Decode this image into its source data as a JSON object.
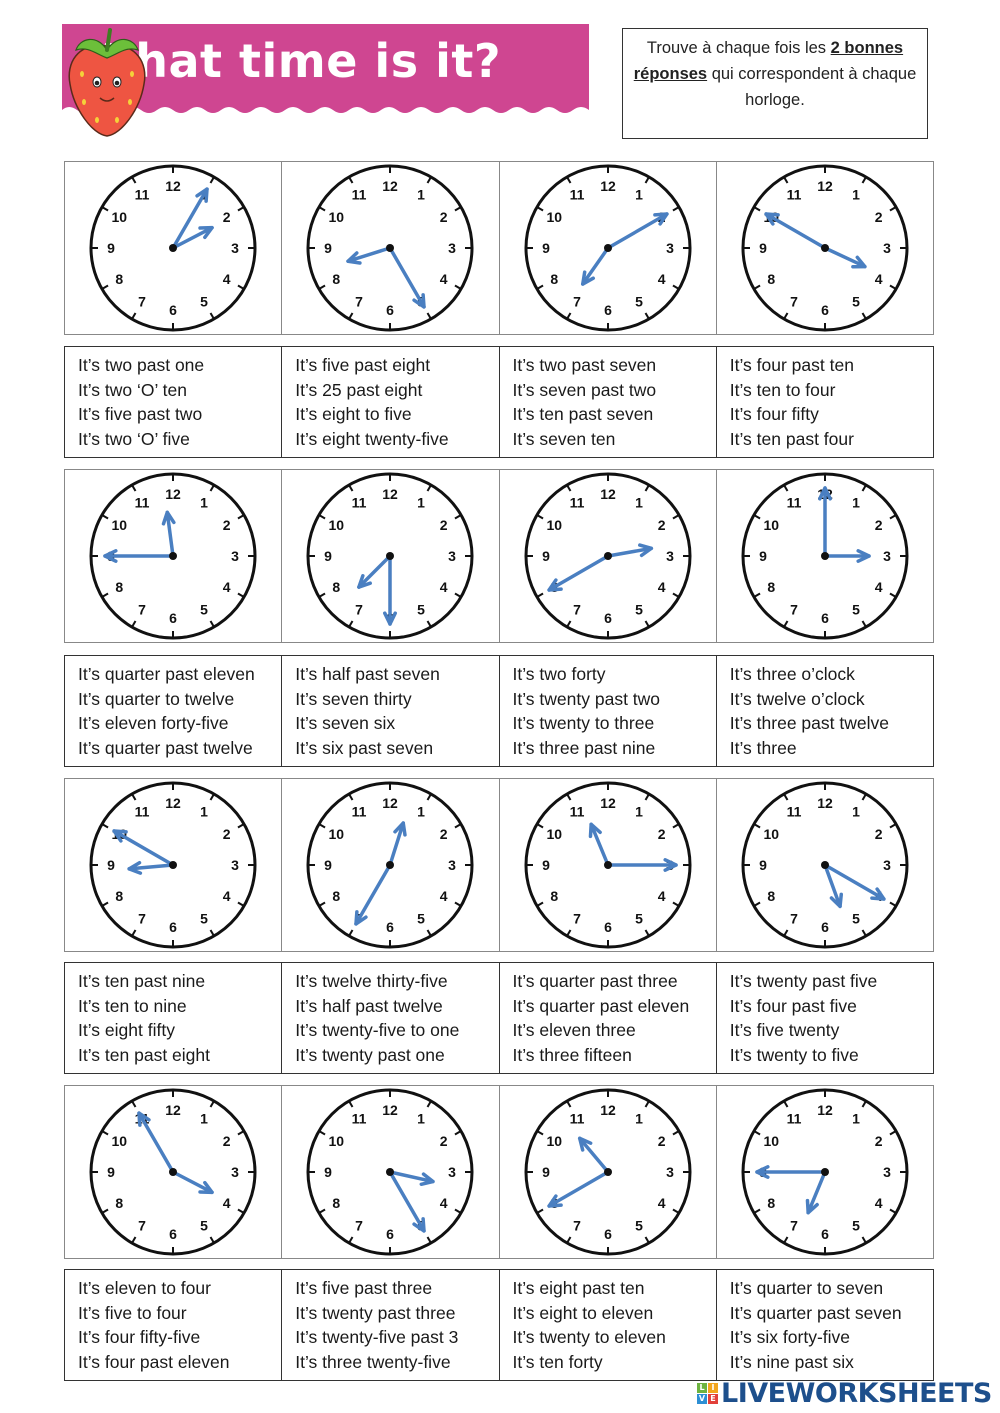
{
  "header": {
    "title": "What time is it?",
    "banner_color": "#cf4691",
    "instructions": {
      "text_before": "Trouve à chaque fois les ",
      "bold_part_1": "2 bonnes",
      "newline_bold": "réponses",
      "text_after": " qui correspondent à chaque horloge."
    }
  },
  "hand_color": "#4a7fc1",
  "rows": [
    {
      "clocks": [
        {
          "hour": 2,
          "minute": 5
        },
        {
          "hour": 8,
          "minute": 25
        },
        {
          "hour": 7,
          "minute": 10
        },
        {
          "hour": 3,
          "minute": 50
        }
      ],
      "answers": [
        [
          "It’s two past one",
          "It’s two ‘O’ ten",
          "It’s five past two",
          "It’s two ‘O’ five"
        ],
        [
          "It’s five past eight",
          "It’s 25 past eight",
          "It’s eight to five",
          "It’s eight twenty-five"
        ],
        [
          "It’s two past seven",
          "It’s seven past two",
          "It’s ten past seven",
          "It’s seven ten"
        ],
        [
          "It’s four past ten",
          "It’s ten to four",
          "It’s four fifty",
          "It’s ten past four"
        ]
      ]
    },
    {
      "clocks": [
        {
          "hour": 11,
          "minute": 45
        },
        {
          "hour": 7,
          "minute": 30
        },
        {
          "hour": 2,
          "minute": 40
        },
        {
          "hour": 3,
          "minute": 0
        }
      ],
      "answers": [
        [
          "It’s quarter past eleven",
          "It’s quarter to twelve",
          "It’s eleven forty-five",
          "It’s quarter past twelve"
        ],
        [
          "It’s half past seven",
          "It’s seven thirty",
          "It’s seven six",
          "It’s six past seven"
        ],
        [
          "It’s two forty",
          "It’s twenty past two",
          "It’s twenty to three",
          "It’s three past nine"
        ],
        [
          "It’s three o’clock",
          "It’s twelve o’clock",
          "It’s three past twelve",
          "It’s three"
        ]
      ]
    },
    {
      "clocks": [
        {
          "hour": 8,
          "minute": 50
        },
        {
          "hour": 12,
          "minute": 35
        },
        {
          "hour": 11,
          "minute": 15
        },
        {
          "hour": 5,
          "minute": 20
        }
      ],
      "answers": [
        [
          "It’s ten past nine",
          "It’s ten to nine",
          "It’s eight fifty",
          "It’s ten past eight"
        ],
        [
          "It’s twelve thirty-five",
          "It’s half past twelve",
          "It’s twenty-five to one",
          "It’s twenty past one"
        ],
        [
          "It’s quarter past three",
          "It’s quarter past eleven",
          "It’s eleven three",
          "It’s three fifteen"
        ],
        [
          "It’s twenty past five",
          "It’s four past five",
          "It’s five twenty",
          "It’s twenty to five"
        ]
      ]
    },
    {
      "clocks": [
        {
          "hour": 3,
          "minute": 55
        },
        {
          "hour": 3,
          "minute": 25
        },
        {
          "hour": 10,
          "minute": 40
        },
        {
          "hour": 6,
          "minute": 45
        }
      ],
      "answers": [
        [
          "It’s eleven to four",
          "It’s five to four",
          "It’s four fifty-five",
          "It’s four past eleven"
        ],
        [
          "It’s five past three",
          "It’s twenty past three",
          "It’s twenty-five past 3",
          "It’s three twenty-five"
        ],
        [
          "It’s eight past ten",
          "It’s eight to eleven",
          "It’s twenty to eleven",
          "It’s ten forty"
        ],
        [
          "It’s quarter to seven",
          "It’s quarter past seven",
          "It’s six forty-five",
          "It’s nine past six"
        ]
      ]
    }
  ],
  "clock_numbers": [
    "12",
    "1",
    "2",
    "3",
    "4",
    "5",
    "6",
    "7",
    "8",
    "9",
    "10",
    "11"
  ],
  "footer": {
    "logo_text": "LIVEWORKSHEETS",
    "logo_letters": [
      "L",
      "I",
      "V",
      "E"
    ],
    "logo_colors": [
      "#6db33f",
      "#f2a51d",
      "#2d8fd4",
      "#e2403a"
    ]
  }
}
